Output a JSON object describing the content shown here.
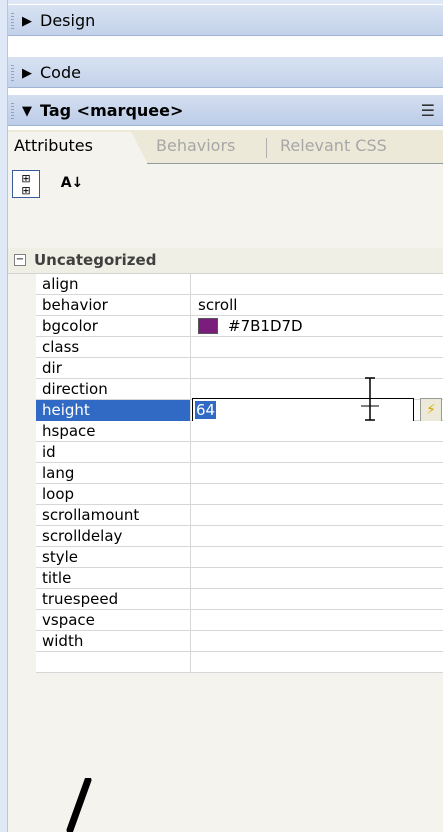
{
  "panels": [
    {
      "label": "Design",
      "arrow": "▶"
    },
    {
      "label": "Code",
      "arrow": "▶"
    },
    {
      "label": "Tag <marquee>",
      "arrow": "▼"
    }
  ],
  "tabs": [
    {
      "label": "Attributes"
    },
    {
      "label": "Behaviors"
    },
    {
      "label": "Relevant CSS"
    }
  ],
  "toolbar": {
    "category_view_icon": "category-view-icon",
    "sort_az_icon": "sort-az-icon",
    "sort_az_label": "A↓"
  },
  "category": {
    "label": "Uncategorized",
    "toggle": "−"
  },
  "attributes": [
    {
      "name": "align",
      "value": ""
    },
    {
      "name": "behavior",
      "value": "scroll"
    },
    {
      "name": "bgcolor",
      "value": "#7B1D7D",
      "swatch": "#7b1d7d"
    },
    {
      "name": "class",
      "value": ""
    },
    {
      "name": "dir",
      "value": ""
    },
    {
      "name": "direction",
      "value": ""
    },
    {
      "name": "height",
      "value": "64",
      "selected": true
    },
    {
      "name": "hspace",
      "value": ""
    },
    {
      "name": "id",
      "value": ""
    },
    {
      "name": "lang",
      "value": ""
    },
    {
      "name": "loop",
      "value": ""
    },
    {
      "name": "scrollamount",
      "value": ""
    },
    {
      "name": "scrolldelay",
      "value": ""
    },
    {
      "name": "style",
      "value": ""
    },
    {
      "name": "title",
      "value": ""
    },
    {
      "name": "truespeed",
      "value": ""
    },
    {
      "name": "vspace",
      "value": ""
    },
    {
      "name": "width",
      "value": ""
    }
  ],
  "tooltip": "64",
  "colors": {
    "selection": "#316ac5",
    "swatch": "#7b1d7d",
    "panel_header": "#c8d6ee"
  }
}
